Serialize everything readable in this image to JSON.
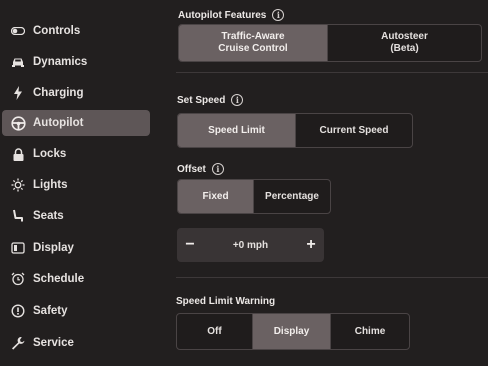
{
  "sidebar": {
    "items": [
      {
        "label": "Controls",
        "icon": "toggle-icon",
        "active": false
      },
      {
        "label": "Dynamics",
        "icon": "car-icon",
        "active": false
      },
      {
        "label": "Charging",
        "icon": "lightning-icon",
        "active": false
      },
      {
        "label": "Autopilot",
        "icon": "steering-wheel-icon",
        "active": true
      },
      {
        "label": "Locks",
        "icon": "lock-icon",
        "active": false
      },
      {
        "label": "Lights",
        "icon": "sun-icon",
        "active": false
      },
      {
        "label": "Seats",
        "icon": "seat-icon",
        "active": false
      },
      {
        "label": "Display",
        "icon": "display-icon",
        "active": false
      },
      {
        "label": "Schedule",
        "icon": "alarm-clock-icon",
        "active": false
      },
      {
        "label": "Safety",
        "icon": "alert-circle-icon",
        "active": false
      },
      {
        "label": "Service",
        "icon": "wrench-icon",
        "active": false
      }
    ]
  },
  "autopilot_features": {
    "label": "Autopilot Features",
    "options": [
      {
        "line1": "Traffic-Aware",
        "line2": "Cruise Control",
        "selected": true
      },
      {
        "line1": "Autosteer",
        "line2": "(Beta)",
        "selected": false
      }
    ]
  },
  "set_speed": {
    "label": "Set Speed",
    "options": [
      "Speed Limit",
      "Current Speed"
    ],
    "selected": "Speed Limit"
  },
  "offset": {
    "label": "Offset",
    "options": [
      "Fixed",
      "Percentage"
    ],
    "selected": "Fixed",
    "value": "+0 mph",
    "minus": "−",
    "plus": "+"
  },
  "speed_limit_warning": {
    "label": "Speed Limit Warning",
    "options": [
      "Off",
      "Display",
      "Chime"
    ],
    "selected": "Display"
  },
  "colors": {
    "background": "#221f1f",
    "selected_segment": "#6a6162",
    "active_nav": "#5e5657"
  }
}
